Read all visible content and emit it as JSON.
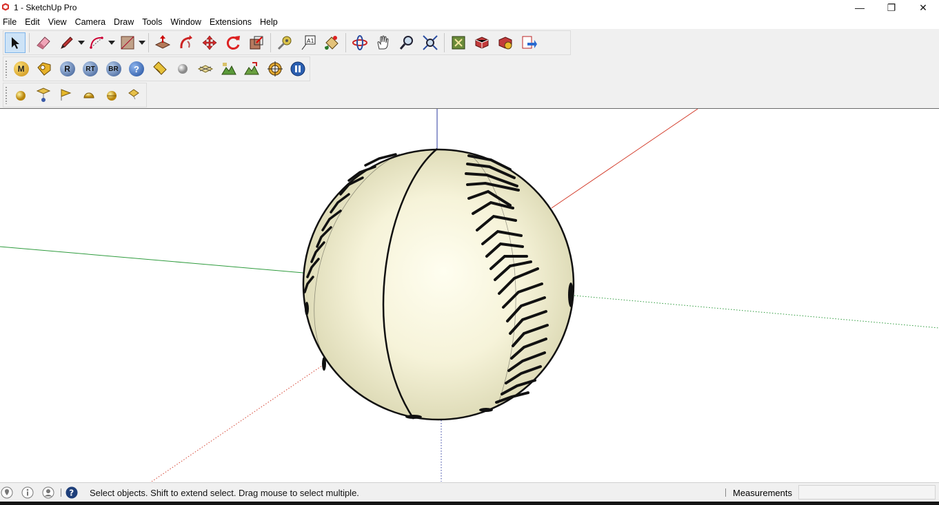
{
  "window": {
    "title": "1 - SketchUp Pro",
    "controls": {
      "minimize": "—",
      "maximize": "❐",
      "close": "✕"
    }
  },
  "menu": [
    "File",
    "Edit",
    "View",
    "Camera",
    "Draw",
    "Tools",
    "Window",
    "Extensions",
    "Help"
  ],
  "toolbars": {
    "main": [
      "select-icon",
      "eraser-icon",
      "pencil-icon",
      "arc-icon",
      "rectangle-icon",
      "push-pull-icon",
      "follow-me-icon",
      "move-icon",
      "rotate-icon",
      "scale-icon",
      "tape-measure-icon",
      "text-icon",
      "paint-bucket-icon",
      "orbit-icon",
      "pan-icon",
      "zoom-icon",
      "zoom-extents-icon",
      "3d-warehouse-icon",
      "extension-warehouse-icon",
      "layout-icon",
      "send-to-layout-icon"
    ],
    "render": {
      "labels": [
        "M",
        "R",
        "RT",
        "BR",
        "?"
      ],
      "icons": [
        "material-icon",
        "tag-icon",
        "render-icon",
        "realtime-render-icon",
        "batch-render-icon",
        "help-icon",
        "label-icon",
        "sphere-icon",
        "plane-icon",
        "landscape-icon",
        "landscape2-icon",
        "target-icon",
        "pause-icon"
      ]
    },
    "lights": [
      "sphere-light-icon",
      "spot-light-icon",
      "flag-light-icon",
      "dome-light-icon",
      "omni-light-icon",
      "ies-light-icon"
    ]
  },
  "colors": {
    "axis_red": "#d33b2a",
    "axis_green": "#2e9b3d",
    "axis_blue": "#2b3a9f",
    "ball_light": "#fbf9e8",
    "ball_shade": "#dcd9b4",
    "active_tool": "#cde3f7"
  },
  "status": {
    "icons": [
      "geo-location-icon",
      "credits-icon",
      "user-icon",
      "instructor-icon"
    ],
    "message": "Select objects. Shift to extend select. Drag mouse to select multiple.",
    "measurements_label": "Measurements",
    "measurements_value": ""
  }
}
